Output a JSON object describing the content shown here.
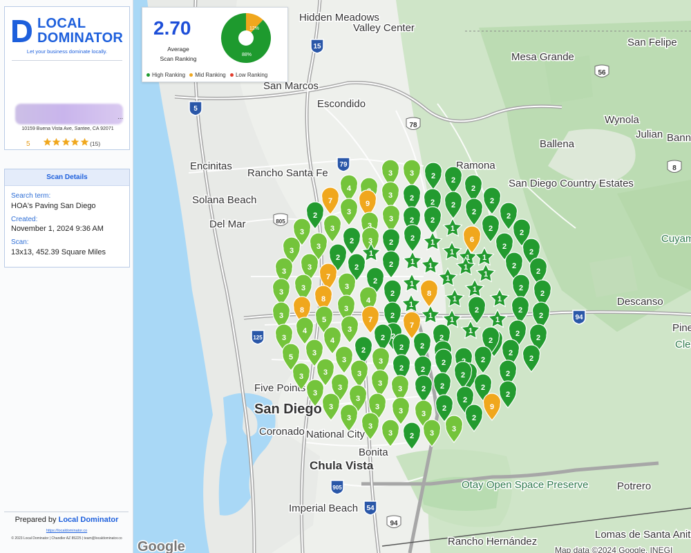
{
  "brand": {
    "line1": "LOCAL",
    "line2": "DOMINATOR",
    "tagline": "Let your business dominate locally."
  },
  "business": {
    "name_redacted_suffix": "...",
    "address": "10159 Buena Vista Ave, Santee, CA 92071",
    "rating": "5",
    "stars": 5,
    "review_count": "(15)"
  },
  "scan_details": {
    "header": "Scan Details",
    "search_term_label": "Search term:",
    "search_term": "HOA's Paving San Diego",
    "created_label": "Created:",
    "created": "November 1, 2024 9:36 AM",
    "scan_label": "Scan:",
    "scan": "13x13, 452.39 Square Miles"
  },
  "footer": {
    "prepared_prefix": "Prepared by",
    "prepared_brand": "Local Dominator",
    "link": "https://localdominator.co",
    "copyright": "© 2023 Local Dominator | Chandler AZ 85225 | team@localdominator.co"
  },
  "summary": {
    "average": "2.70",
    "average_label_line1": "Average",
    "average_label_line2": "Scan Ranking",
    "high_percent": 88,
    "mid_percent": 12,
    "low_percent": 0,
    "high_label": "88%",
    "mid_label": "12%",
    "legend": [
      {
        "label": "High Ranking",
        "color": "#1e9a2e"
      },
      {
        "label": "Mid Ranking",
        "color": "#f0a71d"
      },
      {
        "label": "Low Ranking",
        "color": "#e23c2c"
      }
    ]
  },
  "map": {
    "attribution_logo": "Google",
    "attribution": "Map data ©2024 Google, INEGI",
    "places": [
      "Hidden Meadows",
      "Valley Center",
      "San Felipe",
      "Mesa Grande",
      "San Marcos",
      "Escondido",
      "Wynola",
      "Julian",
      "Banne",
      "Ballena",
      "Ramona",
      "Encinitas",
      "Rancho Santa Fe",
      "San Diego Country Estates",
      "Solana Beach",
      "Del Mar",
      "Cuyamac Rancho State Par",
      "Descanso",
      "Pine",
      "Cle Natio",
      "Five Points",
      "San Diego",
      "Coronado",
      "National City",
      "Bonita",
      "Chula Vista",
      "Otay Open Space Preserve",
      "Potrero",
      "Imperial Beach",
      "Rancho Hernández",
      "Lomas de Santa Anita"
    ],
    "highways": [
      "15",
      "5",
      "78",
      "79",
      "56",
      "8",
      "805",
      "94",
      "125",
      "54",
      "905",
      "94"
    ],
    "pin_colors": {
      "dark": "#239b2f",
      "light": "#74c43b",
      "mid": "#f0a71d"
    }
  }
}
